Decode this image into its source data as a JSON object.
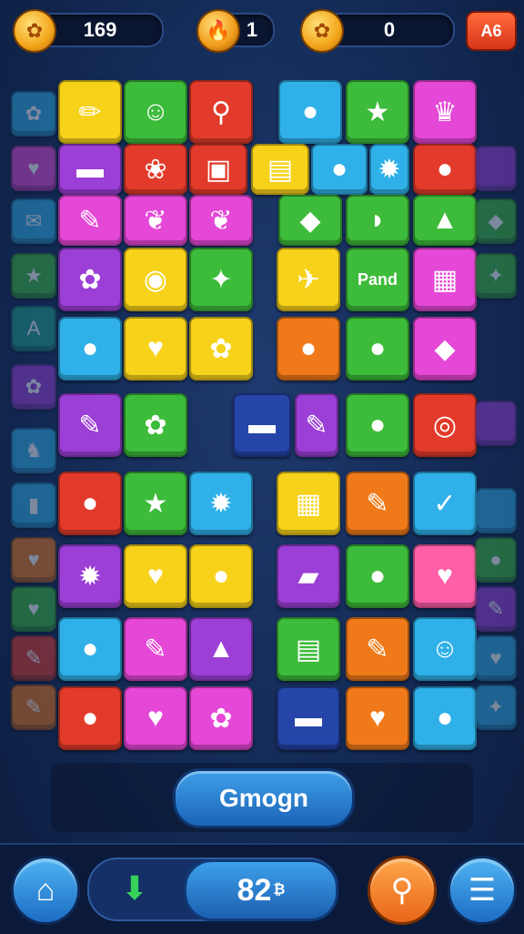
{
  "top_bar": {
    "coins": "169",
    "flames": "1",
    "gems": "0",
    "menu_label": "A6"
  },
  "colors": {
    "yellow": "#f7d21a",
    "green": "#3dbb3a",
    "red": "#e33b2b",
    "blue": "#2fb0e8",
    "magenta": "#e547d6",
    "purple": "#9b3fd6",
    "orange": "#f07a1a",
    "pink": "#ff5fa8",
    "navy": "#2545a8",
    "teal": "#1f9e8a"
  },
  "board_rows": [
    [
      [
        "yellow",
        "✏",
        "pencil"
      ],
      [
        "green",
        "☺",
        "ghost"
      ],
      [
        "red",
        "⚲",
        "lollipop"
      ],
      [
        "blue",
        "●",
        "bird"
      ],
      [
        "green",
        "★",
        "star"
      ],
      [
        "magenta",
        "♛",
        "crown"
      ]
    ],
    [
      [
        "purple",
        "▬",
        "bar"
      ],
      [
        "red",
        "❀",
        "berries"
      ],
      [
        "red",
        "▣",
        "frame"
      ],
      [
        "yellow",
        "▤",
        "crate"
      ],
      [
        "blue",
        "●",
        "plum"
      ],
      [
        "blue",
        "✹",
        "sun"
      ],
      [
        "red",
        "●",
        "candy"
      ]
    ],
    [
      [
        "magenta",
        "✎",
        "brush"
      ],
      [
        "magenta",
        "❦",
        "fruit"
      ],
      [
        "magenta",
        "❦",
        "fruit"
      ],
      [
        "green",
        "◆",
        "fish"
      ],
      [
        "green",
        "◗",
        "bread"
      ],
      [
        "green",
        "▲",
        "cone"
      ]
    ],
    [
      [
        "purple",
        "✿",
        "flowers"
      ],
      [
        "yellow",
        "◉",
        "ball"
      ],
      [
        "green",
        "✦",
        "leaf"
      ],
      [
        "yellow",
        "✈",
        "plane"
      ],
      [
        "green",
        "Pand",
        "word"
      ],
      [
        "magenta",
        "▦",
        "cube"
      ]
    ],
    [
      [
        "blue",
        "●",
        "lemon"
      ],
      [
        "yellow",
        "♥",
        "heart"
      ],
      [
        "yellow",
        "✿",
        "bow"
      ],
      [
        "orange",
        "●",
        "pumpkin"
      ],
      [
        "green",
        "●",
        "grape"
      ],
      [
        "magenta",
        "◆",
        "gold"
      ]
    ],
    [
      [
        "purple",
        "✎",
        "tool"
      ],
      [
        "green",
        "✿",
        "cookies"
      ],
      [
        "navy",
        "▬",
        "cake"
      ],
      [
        "purple",
        "✎",
        "torch"
      ],
      [
        "green",
        "●",
        "lemon"
      ],
      [
        "red",
        "◎",
        "button"
      ]
    ],
    [
      [
        "red",
        "●",
        "blueberry"
      ],
      [
        "green",
        "★",
        "star"
      ],
      [
        "blue",
        "✹",
        "gear"
      ],
      [
        "yellow",
        "▦",
        "dice"
      ],
      [
        "orange",
        "✎",
        "pencil"
      ],
      [
        "blue",
        "✓",
        "check"
      ]
    ],
    [
      [
        "purple",
        "✹",
        "sun"
      ],
      [
        "yellow",
        "♥",
        "heart"
      ],
      [
        "yellow",
        "●",
        "key"
      ],
      [
        "purple",
        "▰",
        "eraser"
      ],
      [
        "green",
        "●",
        "lime"
      ],
      [
        "pink",
        "♥",
        "heart"
      ]
    ],
    [
      [
        "blue",
        "●",
        "apple"
      ],
      [
        "magenta",
        "✎",
        "pencil"
      ],
      [
        "purple",
        "▲",
        "cake"
      ],
      [
        "green",
        "▤",
        "book"
      ],
      [
        "orange",
        "✎",
        "brush"
      ],
      [
        "blue",
        "☺",
        "smiley"
      ]
    ],
    [
      [
        "red",
        "●",
        "frog"
      ],
      [
        "magenta",
        "♥",
        "heart"
      ],
      [
        "magenta",
        "✿",
        "candy"
      ],
      [
        "navy",
        "▬",
        "ice"
      ],
      [
        "orange",
        "♥",
        "heart"
      ],
      [
        "blue",
        "●",
        "balloon"
      ]
    ]
  ],
  "side_left": [
    "✿",
    "♥",
    "✉",
    "★",
    "A",
    "✿",
    "♞",
    "▮",
    "♥",
    "♥",
    "✎",
    "✎"
  ],
  "side_right": [
    "",
    "◆",
    "✦",
    "",
    "",
    "●",
    "✎",
    "♥",
    "✦"
  ],
  "action_button": "Gmogn",
  "footer": {
    "score": "82",
    "score_suffix": "₿"
  },
  "icons": [
    "coin-icon",
    "flame-icon",
    "gem-icon",
    "home-icon",
    "arrow-down-icon",
    "search-icon",
    "menu-icon"
  ]
}
